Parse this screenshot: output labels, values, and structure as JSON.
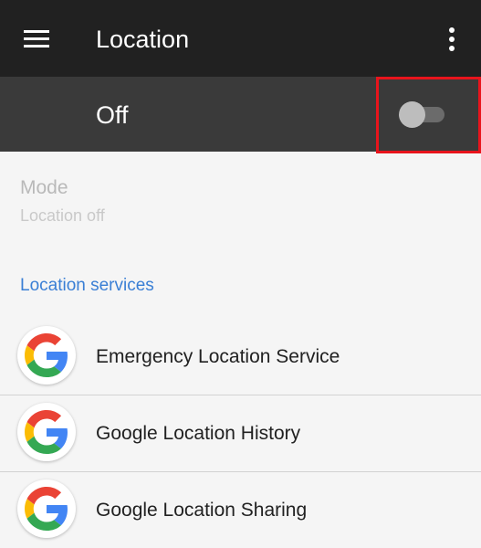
{
  "toolbar": {
    "title": "Location",
    "menu_icon": "hamburger-menu-icon",
    "overflow_icon": "more-vert-icon"
  },
  "master_switch": {
    "label": "Off",
    "state": "off"
  },
  "mode": {
    "title": "Mode",
    "subtitle": "Location off"
  },
  "location_services": {
    "header": "Location services",
    "items": [
      {
        "label": "Emergency Location Service",
        "icon": "google-g-icon"
      },
      {
        "label": "Google Location History",
        "icon": "google-g-icon"
      },
      {
        "label": "Google Location Sharing",
        "icon": "google-g-icon"
      }
    ]
  },
  "colors": {
    "toolbar_bg": "#212121",
    "switchbar_bg": "#3a3a3a",
    "accent": "#3a7fd5",
    "highlight": "#e8141c",
    "google_blue": "#4285F4",
    "google_red": "#EA4335",
    "google_yellow": "#FBBC05",
    "google_green": "#34A853"
  }
}
